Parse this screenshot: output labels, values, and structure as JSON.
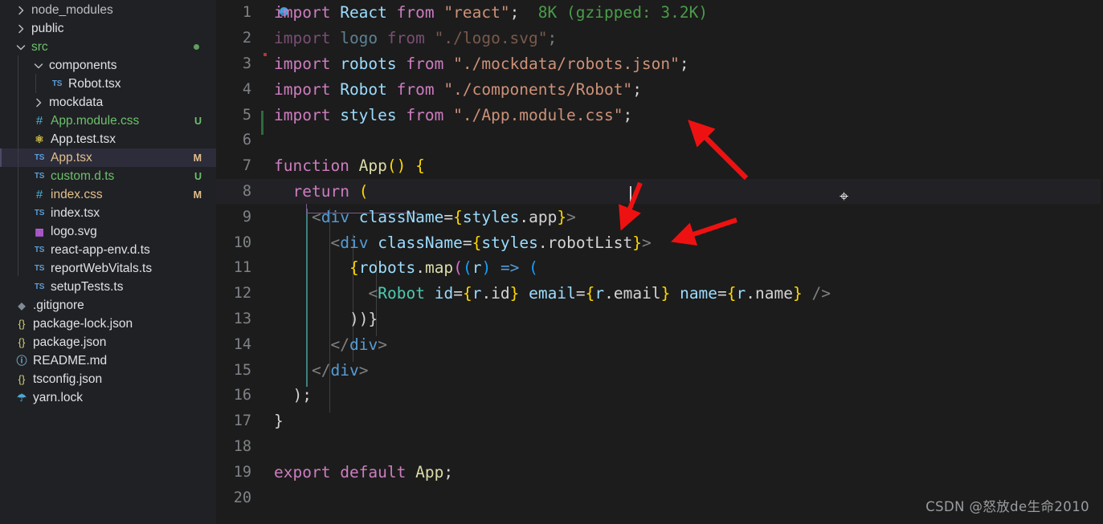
{
  "sidebar": {
    "items": [
      {
        "label": "node_modules",
        "icon": "chevron-right-icon",
        "type": "folder",
        "state": "collapsed",
        "indent": 0,
        "color": "dim",
        "badge": ""
      },
      {
        "label": "public",
        "icon": "chevron-right-icon",
        "type": "folder",
        "state": "collapsed",
        "indent": 0,
        "color": "white",
        "badge": ""
      },
      {
        "label": "src",
        "icon": "chevron-down-icon",
        "type": "folder",
        "state": "expanded",
        "indent": 0,
        "color": "green",
        "badge": "",
        "dot": true
      },
      {
        "label": "components",
        "icon": "chevron-down-icon",
        "type": "folder",
        "state": "expanded",
        "indent": 1,
        "color": "white",
        "badge": ""
      },
      {
        "label": "Robot.tsx",
        "icon": "ts-file-icon",
        "type": "file",
        "indent": 2,
        "color": "white",
        "badge": ""
      },
      {
        "label": "mockdata",
        "icon": "chevron-right-icon",
        "type": "folder",
        "state": "collapsed",
        "indent": 1,
        "color": "white",
        "badge": ""
      },
      {
        "label": "App.module.css",
        "icon": "css-file-icon",
        "type": "file",
        "indent": 1,
        "color": "green",
        "badge": "U"
      },
      {
        "label": "App.test.tsx",
        "icon": "react-file-icon",
        "type": "file",
        "indent": 1,
        "color": "white",
        "badge": ""
      },
      {
        "label": "App.tsx",
        "icon": "ts-file-icon",
        "type": "file",
        "indent": 1,
        "color": "orange",
        "badge": "M",
        "selected": true
      },
      {
        "label": "custom.d.ts",
        "icon": "ts-file-icon",
        "type": "file",
        "indent": 1,
        "color": "green",
        "badge": "U"
      },
      {
        "label": "index.css",
        "icon": "css-file-icon",
        "type": "file",
        "indent": 1,
        "color": "orange",
        "badge": "M"
      },
      {
        "label": "index.tsx",
        "icon": "ts-file-icon",
        "type": "file",
        "indent": 1,
        "color": "white",
        "badge": ""
      },
      {
        "label": "logo.svg",
        "icon": "svg-file-icon",
        "type": "file",
        "indent": 1,
        "color": "white",
        "badge": ""
      },
      {
        "label": "react-app-env.d.ts",
        "icon": "ts-file-icon",
        "type": "file",
        "indent": 1,
        "color": "white",
        "badge": ""
      },
      {
        "label": "reportWebVitals.ts",
        "icon": "ts-file-icon",
        "type": "file",
        "indent": 1,
        "color": "white",
        "badge": ""
      },
      {
        "label": "setupTests.ts",
        "icon": "ts-file-icon",
        "type": "file",
        "indent": 1,
        "color": "white",
        "badge": ""
      },
      {
        "label": ".gitignore",
        "icon": "git-file-icon",
        "type": "file",
        "indent": 0,
        "color": "white",
        "badge": ""
      },
      {
        "label": "package-lock.json",
        "icon": "json-file-icon",
        "type": "file",
        "indent": 0,
        "color": "white",
        "badge": ""
      },
      {
        "label": "package.json",
        "icon": "json-file-icon",
        "type": "file",
        "indent": 0,
        "color": "white",
        "badge": ""
      },
      {
        "label": "README.md",
        "icon": "markdown-info-icon",
        "type": "file",
        "indent": 0,
        "color": "white",
        "badge": ""
      },
      {
        "label": "tsconfig.json",
        "icon": "json-file-icon",
        "type": "file",
        "indent": 0,
        "color": "white",
        "badge": ""
      },
      {
        "label": "yarn.lock",
        "icon": "yarn-file-icon",
        "type": "file",
        "indent": 0,
        "color": "white",
        "badge": ""
      }
    ]
  },
  "editor": {
    "language": "typescriptreact",
    "file": "App.tsx",
    "current_line": 8,
    "line_numbers": [
      "1",
      "2",
      "3",
      "4",
      "5",
      "6",
      "7",
      "8",
      "9",
      "10",
      "11",
      "12",
      "13",
      "14",
      "15",
      "16",
      "17",
      "18",
      "19",
      "20"
    ],
    "lines": [
      {
        "n": "1",
        "text": "import React from \"react\";",
        "hint": "8K (gzipped: 3.2K)"
      },
      {
        "n": "2",
        "text": "import logo from \"./logo.svg\";",
        "dimmed": true
      },
      {
        "n": "3",
        "text": "import robots from \"./mockdata/robots.json\";"
      },
      {
        "n": "4",
        "text": "import Robot from \"./components/Robot\";"
      },
      {
        "n": "5",
        "text": "import styles from \"./App.module.css\";"
      },
      {
        "n": "6",
        "text": ""
      },
      {
        "n": "7",
        "text": "function App() {"
      },
      {
        "n": "8",
        "text": "  return ("
      },
      {
        "n": "9",
        "text": "    <div className={styles.app}>"
      },
      {
        "n": "10",
        "text": "      <div className={styles.robotList}>"
      },
      {
        "n": "11",
        "text": "        {robots.map((r) => ("
      },
      {
        "n": "12",
        "text": "          <Robot id={r.id} email={r.email} name={r.name} />"
      },
      {
        "n": "13",
        "text": "        ))}"
      },
      {
        "n": "14",
        "text": "      </div>"
      },
      {
        "n": "15",
        "text": "    </div>"
      },
      {
        "n": "16",
        "text": "  );"
      },
      {
        "n": "17",
        "text": "}"
      },
      {
        "n": "18",
        "text": ""
      },
      {
        "n": "19",
        "text": "export default App;"
      },
      {
        "n": "20",
        "text": ""
      }
    ],
    "import_cost_hint": "8K (gzipped: 3.2K)"
  },
  "annotations": {
    "arrow_color": "#ee1111",
    "arrows": [
      {
        "name": "arrow-to-app-module-css",
        "target": "\"./App.module.css\";"
      },
      {
        "name": "arrow-to-styles-app",
        "target": "{styles.app}"
      },
      {
        "name": "arrow-to-styles-robotlist",
        "target": "{styles.robotList}"
      }
    ]
  },
  "watermark": {
    "text": "CSDN @怒放de生命2010"
  },
  "colors": {
    "sidebar_bg": "#202124",
    "editor_bg": "#1c1c1c",
    "selection_bg": "#2d2c3a",
    "keyword": "#cd7dc0",
    "string": "#ce9178",
    "variable": "#9cdcfe",
    "function": "#dcdcaa",
    "tag": "#569cd6",
    "component": "#4ec9b0",
    "untracked": "#6cc06c",
    "modified": "#e2c08d",
    "import_cost": "#4a9c4a"
  }
}
